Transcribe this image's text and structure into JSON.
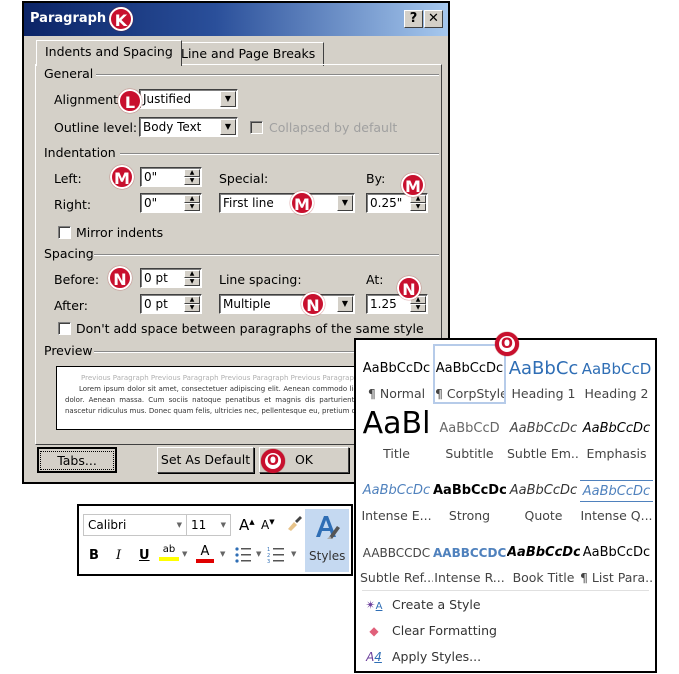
{
  "dialog": {
    "title": "Paragraph",
    "help_label": "?",
    "close_label": "✕",
    "tabs": [
      {
        "label": "Indents and Spacing",
        "active": true
      },
      {
        "label": "Line and Page Breaks",
        "active": false
      }
    ],
    "general": {
      "heading": "General",
      "alignment_label": "Alignment:",
      "alignment_value": "Justified",
      "outline_label": "Outline level:",
      "outline_value": "Body Text",
      "collapsed_label": "Collapsed by default"
    },
    "indentation": {
      "heading": "Indentation",
      "left_label": "Left:",
      "left_value": "0\"",
      "right_label": "Right:",
      "right_value": "0\"",
      "special_label": "Special:",
      "special_value": "First line",
      "by_label": "By:",
      "by_value": "0.25\"",
      "mirror_label": "Mirror indents"
    },
    "spacing": {
      "heading": "Spacing",
      "before_label": "Before:",
      "before_value": "0 pt",
      "after_label": "After:",
      "after_value": "0 pt",
      "line_spacing_label": "Line spacing:",
      "line_spacing_value": "Multiple",
      "at_label": "At:",
      "at_value": "1.25",
      "dont_add_label": "Don't add space between paragraphs of the same style"
    },
    "preview": {
      "heading": "Preview",
      "previous_text": "Previous Paragraph Previous Paragraph Previous Paragraph Previous Paragraph Previous",
      "body_text": "Lorem ipsum dolor sit amet, consectetuer adipiscing elit. Aenean commodo ligula eget dolor. Aenean massa. Cum sociis natoque penatibus et magnis dis parturient montes, nascetur ridiculus mus. Donec quam felis, ultricies nec, pellentesque eu, pretium quis,"
    },
    "buttons": {
      "tabs": "Tabs...",
      "set_default": "Set As Default",
      "ok": "OK"
    }
  },
  "callouts": {
    "k": "K",
    "l": "L",
    "m": "M",
    "n": "N",
    "o": "O"
  },
  "ribbon": {
    "font_name": "Calibri",
    "font_size": "11",
    "grow_font": "A",
    "shrink_font": "A",
    "bold": "B",
    "italic": "I",
    "underline": "U",
    "highlight_label": "ab",
    "font_color_label": "A",
    "styles_label": "Styles",
    "highlight_color": "#ffff00",
    "font_color": "#e00000"
  },
  "gallery": {
    "styles": [
      {
        "sample": "AaBbCcDc",
        "name": "¶ Normal"
      },
      {
        "sample": "AaBbCcDc",
        "name": "¶ CorpStyle",
        "selected": true
      },
      {
        "sample": "AaBbCc",
        "name": "Heading 1"
      },
      {
        "sample": "AaBbCcD",
        "name": "Heading 2"
      },
      {
        "sample": "AaBl",
        "name": "Title"
      },
      {
        "sample": "AaBbCcD",
        "name": "Subtitle"
      },
      {
        "sample": "AaBbCcDc",
        "name": "Subtle Em..."
      },
      {
        "sample": "AaBbCcDc",
        "name": "Emphasis"
      },
      {
        "sample": "AaBbCcDc",
        "name": "Intense E..."
      },
      {
        "sample": "AaBbCcDc",
        "name": "Strong"
      },
      {
        "sample": "AaBbCcDc",
        "name": "Quote"
      },
      {
        "sample": "AaBbCcDc",
        "name": "Intense Q..."
      },
      {
        "sample": "AABBCCDC",
        "name": "Subtle Ref..."
      },
      {
        "sample": "AABBCCDC",
        "name": "Intense R..."
      },
      {
        "sample": "AaBbCcDc",
        "name": "Book Title"
      },
      {
        "sample": "AaBbCcDc",
        "name": "¶ List Para..."
      }
    ],
    "menu": [
      {
        "icon": "create-style-icon",
        "label": "Create a Style"
      },
      {
        "icon": "clear-formatting-icon",
        "label": "Clear Formatting"
      },
      {
        "icon": "apply-styles-icon",
        "label": "Apply Styles..."
      }
    ],
    "accent_color": "#4f81bd",
    "selection_color": "#b6cbe9"
  }
}
